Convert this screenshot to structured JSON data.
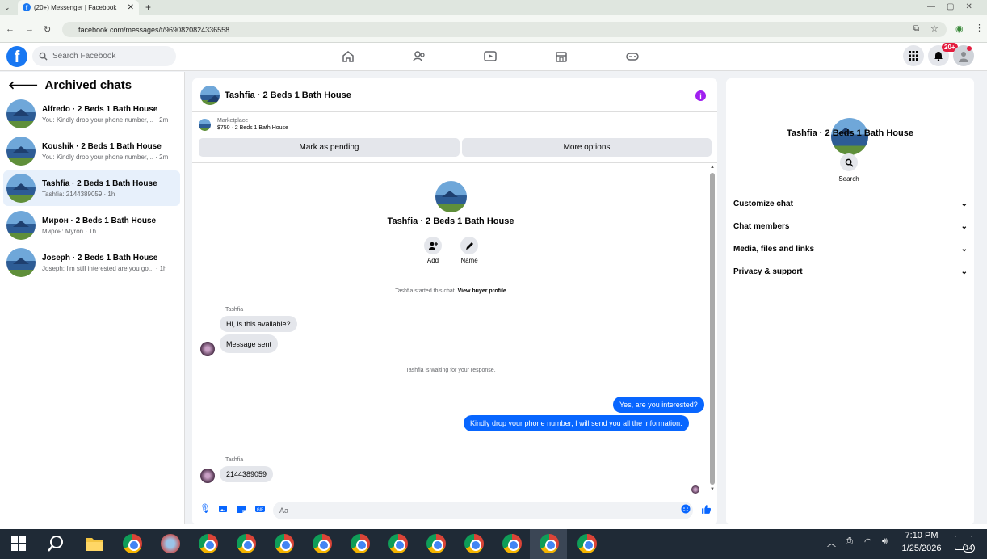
{
  "browser": {
    "tab_title": "(20+) Messenger | Facebook",
    "url": "facebook.com/messages/t/9690820824336558"
  },
  "fb": {
    "search_placeholder": "Search Facebook",
    "notif_badge": "20+"
  },
  "sidebar": {
    "title": "Archived chats",
    "chats": [
      {
        "title": "Alfredo · 2 Beds 1 Bath House",
        "snippet": "You: Kindly drop your phone number,... · 2m",
        "active": false
      },
      {
        "title": "Koushik · 2 Beds 1 Bath House",
        "snippet": "You: Kindly drop your phone number,... · 2m",
        "active": false
      },
      {
        "title": "Tashfia · 2 Beds 1 Bath House",
        "snippet": "Tashfia: 2144389059 · 1h",
        "active": true
      },
      {
        "title": "Мирон · 2 Beds 1 Bath House",
        "snippet": "Мирон: Myron · 1h",
        "active": false
      },
      {
        "title": "Joseph · 2 Beds 1 Bath House",
        "snippet": "Joseph: I'm still interested are you go... · 1h",
        "active": false
      }
    ]
  },
  "conversation": {
    "title": "Tashfia · 2 Beds 1 Bath House",
    "marketplace_label": "Marketplace",
    "listing": "$750 · 2 Beds 1 Bath House",
    "mark_pending": "Mark as pending",
    "more_options": "More options",
    "profile_name": "Tashfia · 2 Beds 1 Bath House",
    "add_label": "Add",
    "name_label": "Name",
    "started_text": "Tashfia started this chat.",
    "view_buyer": "View buyer profile",
    "sender1": "Tashfia",
    "msg1": "Hi, is this available?",
    "msg2": "Message sent",
    "waiting": "Tashfia is waiting for your response.",
    "out1": "Yes, are you interested?",
    "out2": "Kindly drop your phone number, I will send you all the information.",
    "sender2": "Tashfia",
    "msg3": "2144389059",
    "composer_placeholder": "Aa"
  },
  "details": {
    "name": "Tashfia · 2 Beds 1 Bath House",
    "search_label": "Search",
    "sections": [
      "Customize chat",
      "Chat members",
      "Media, files and links",
      "Privacy & support"
    ]
  },
  "taskbar": {
    "time": "7:10 PM",
    "date": "1/25/2026",
    "notif_count": "14"
  }
}
